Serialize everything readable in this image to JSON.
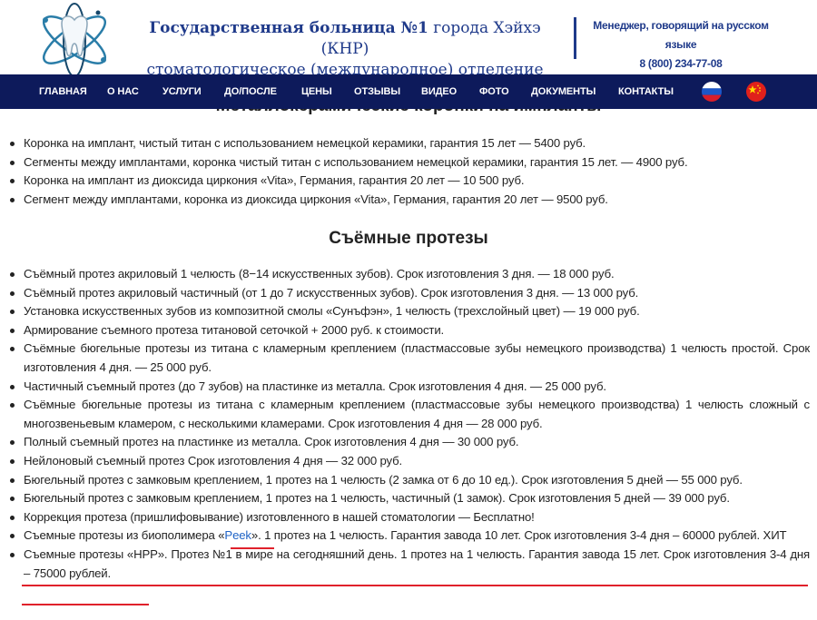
{
  "header": {
    "title_bold": "Государственная больница №1",
    "title_rest": " города Хэйхэ (КНР)",
    "subtitle": "стоматологическое (международное) отделение",
    "manager_label": "Менеджер, говорящий на русском языке",
    "phone": "8 (800) 234-77-08"
  },
  "nav": {
    "items": [
      "Главная",
      "О нас",
      "Услуги",
      "До/после",
      "Цены",
      "Отзывы",
      "Видео",
      "Фото",
      "Документы",
      "Контакты"
    ],
    "flags": [
      "russia-flag",
      "china-flag"
    ]
  },
  "sections": {
    "partial_heading": "Металлокерамические коронки на импланты",
    "implant_items": [
      "Коронка на имплант, чистый титан с использованием немецкой керамики, гарантия 15 лет — 5400 руб.",
      "Сегменты между имплантами, коронка чистый титан с использованием немецкой керамики, гарантия 15 лет. — 4900 руб.",
      "Коронка на имплант из диоксида циркония «Vita», Германия, гарантия 20 лет — 10 500 руб.",
      "Сегмент между имплантами, коронка из диоксида циркония «Vita», Германия, гарантия 20 лет — 9500 руб."
    ],
    "removable_title": "Съёмные протезы",
    "removable_items": [
      "Съёмный протез акриловый 1 челюсть (8−14 искусственных зубов). Срок изготовления 3 дня. — 18 000 руб.",
      "Съёмный протез акриловый частичный (от 1 до 7 искусственных зубов). Срок изготовления 3 дня. — 13 000 руб.",
      "Установка искусственных зубов из композитной смолы «Сунъфэн», 1 челюсть (трехслойный цвет) — 19 000 руб.",
      "Армирование съемного протеза титановой сеточкой + 2000 руб. к стоимости.",
      "Съёмные бюгельные протезы из титана с кламерным креплением (пластмассовые зубы немецкого производства) 1 челюсть простой. Срок изготовления 4 дня. — 25 000 руб.",
      "Частичный съемный протез (до 7 зубов) на пластинке из металла. Срок изготовления 4 дня. — 25 000 руб.",
      "Съёмные бюгельные протезы из титана с кламерным креплением (пластмассовые зубы немецкого производства) 1 челюсть сложный с многозвеньевым кламером, с несколькими кламерами. Срок изготовления 4 дня — 28 000 руб.",
      "Полный съемный протез на пластинке из металла. Срок изготовления 4 дня — 30 000 руб.",
      "Нейлоновый съемный протез Срок изготовления 4 дня — 32 000 руб.",
      "Бюгельный протез с замковым креплением, 1 протез на 1 челюсть (2 замка от 6 до 10 ед.). Срок изготовления 5 дней — 55 000 руб.",
      "Бюгельный протез с замковым креплением, 1 протез на 1 челюсть, частичный (1 замок). Срок изготовления 5 дней — 39 000 руб.",
      "Коррекция протеза (пришлифовывание) изготовленного в нашей стоматологии — Бесплатно!"
    ],
    "peek_item": {
      "before": "Съемные протезы из биополимера «",
      "link": "Peek",
      "after": "». 1 протез на 1 челюсть. Гарантия завода 10 лет. Срок изготовления 3-4 дня – 60000 рублей. ХИТ"
    },
    "hpp_item": "Съемные протезы «HPP». Протез №1 в мире на сегодняшний день. 1 протез на 1 челюсть. Гарантия завода 15 лет. Срок изготовления 3-4 дня – 75000 рублей."
  },
  "colors": {
    "nav_bg": "#0d1a5b",
    "brand_blue": "#1f3a8a",
    "link_blue": "#1f63c6",
    "highlight_red": "#e0212b"
  }
}
